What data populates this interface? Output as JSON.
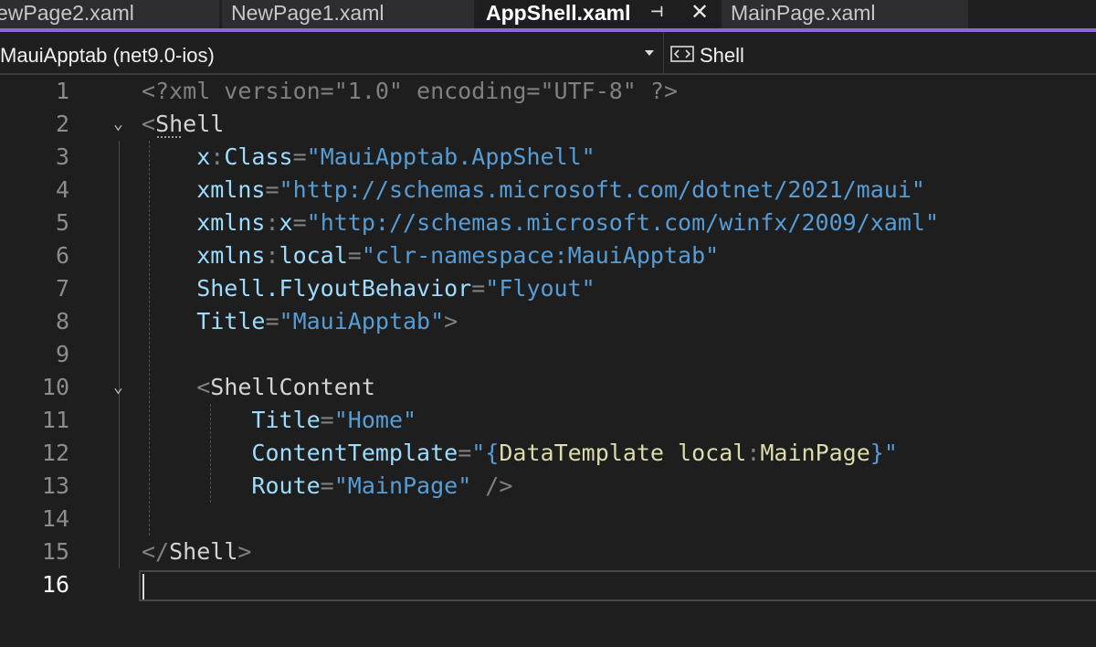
{
  "tabs": [
    {
      "label": "ewPage2.xaml",
      "active": false
    },
    {
      "label": "NewPage1.xaml",
      "active": false
    },
    {
      "label": "AppShell.xaml",
      "active": true,
      "pin_icon": "pin-icon",
      "close_icon": "close-icon"
    },
    {
      "label": "MainPage.xaml",
      "active": false
    }
  ],
  "tab_glyphs": {
    "pin": "⊣",
    "close": "✕"
  },
  "navbar": {
    "project": "MauiApptab (net9.0-ios)",
    "member_icon": "shell-member-icon",
    "member": "Shell"
  },
  "colors": {
    "accent": "#8a6bd6",
    "background": "#1e1e1e",
    "tag": "#d4d4d4",
    "attribute": "#9cdcfe",
    "string": "#569cd6",
    "markup_extension": "#dcdcaa",
    "punctuation": "#808080"
  },
  "editor": {
    "current_line": 16,
    "fold_glyph": "⌄",
    "lines": [
      {
        "n": "1",
        "parts": [
          {
            "t": "<?xml version=\"1.0\" encoding=\"UTF-8\" ?>",
            "c": "dim"
          }
        ]
      },
      {
        "n": "2",
        "fold": true,
        "parts": [
          {
            "t": "<",
            "c": "punct"
          },
          {
            "t": "Shell",
            "c": "tag"
          }
        ]
      },
      {
        "n": "3",
        "parts": [
          {
            "t": "    x",
            "c": "attr"
          },
          {
            "t": ":",
            "c": "punct"
          },
          {
            "t": "Class",
            "c": "attr"
          },
          {
            "t": "=",
            "c": "punct"
          },
          {
            "t": "\"MauiApptab.AppShell\"",
            "c": "str"
          }
        ]
      },
      {
        "n": "4",
        "parts": [
          {
            "t": "    xmlns",
            "c": "attr"
          },
          {
            "t": "=",
            "c": "punct"
          },
          {
            "t": "\"http://schemas.microsoft.com/dotnet/2021/maui\"",
            "c": "str"
          }
        ]
      },
      {
        "n": "5",
        "parts": [
          {
            "t": "    xmlns",
            "c": "attr"
          },
          {
            "t": ":",
            "c": "punct"
          },
          {
            "t": "x",
            "c": "attr"
          },
          {
            "t": "=",
            "c": "punct"
          },
          {
            "t": "\"http://schemas.microsoft.com/winfx/2009/xaml\"",
            "c": "str"
          }
        ]
      },
      {
        "n": "6",
        "parts": [
          {
            "t": "    xmlns",
            "c": "attr"
          },
          {
            "t": ":",
            "c": "punct"
          },
          {
            "t": "local",
            "c": "attr"
          },
          {
            "t": "=",
            "c": "punct"
          },
          {
            "t": "\"clr-namespace:MauiApptab\"",
            "c": "str"
          }
        ]
      },
      {
        "n": "7",
        "parts": [
          {
            "t": "    Shell.FlyoutBehavior",
            "c": "attr"
          },
          {
            "t": "=",
            "c": "punct"
          },
          {
            "t": "\"Flyout\"",
            "c": "str"
          }
        ]
      },
      {
        "n": "8",
        "parts": [
          {
            "t": "    Title",
            "c": "attr"
          },
          {
            "t": "=",
            "c": "punct"
          },
          {
            "t": "\"MauiApptab\"",
            "c": "str"
          },
          {
            "t": ">",
            "c": "punct"
          }
        ]
      },
      {
        "n": "9",
        "parts": []
      },
      {
        "n": "10",
        "fold": true,
        "parts": [
          {
            "t": "    ",
            "c": "tag"
          },
          {
            "t": "<",
            "c": "punct"
          },
          {
            "t": "ShellContent",
            "c": "tag"
          }
        ]
      },
      {
        "n": "11",
        "parts": [
          {
            "t": "        Title",
            "c": "attr"
          },
          {
            "t": "=",
            "c": "punct"
          },
          {
            "t": "\"Home\"",
            "c": "str"
          }
        ]
      },
      {
        "n": "12",
        "parts": [
          {
            "t": "        ContentTemplate",
            "c": "attr"
          },
          {
            "t": "=",
            "c": "punct"
          },
          {
            "t": "\"{",
            "c": "str"
          },
          {
            "t": "DataTemplate",
            "c": "ext"
          },
          {
            "t": " ",
            "c": "tag"
          },
          {
            "t": "local",
            "c": "ext"
          },
          {
            "t": ":",
            "c": "punct"
          },
          {
            "t": "MainPage",
            "c": "ext"
          },
          {
            "t": "}\"",
            "c": "str"
          }
        ]
      },
      {
        "n": "13",
        "parts": [
          {
            "t": "        Route",
            "c": "attr"
          },
          {
            "t": "=",
            "c": "punct"
          },
          {
            "t": "\"MainPage\"",
            "c": "str"
          },
          {
            "t": " />",
            "c": "punct"
          }
        ]
      },
      {
        "n": "14",
        "parts": []
      },
      {
        "n": "15",
        "parts": [
          {
            "t": "</",
            "c": "punct"
          },
          {
            "t": "Shell",
            "c": "tag"
          },
          {
            "t": ">",
            "c": "punct"
          }
        ]
      },
      {
        "n": "16",
        "parts": []
      }
    ]
  }
}
